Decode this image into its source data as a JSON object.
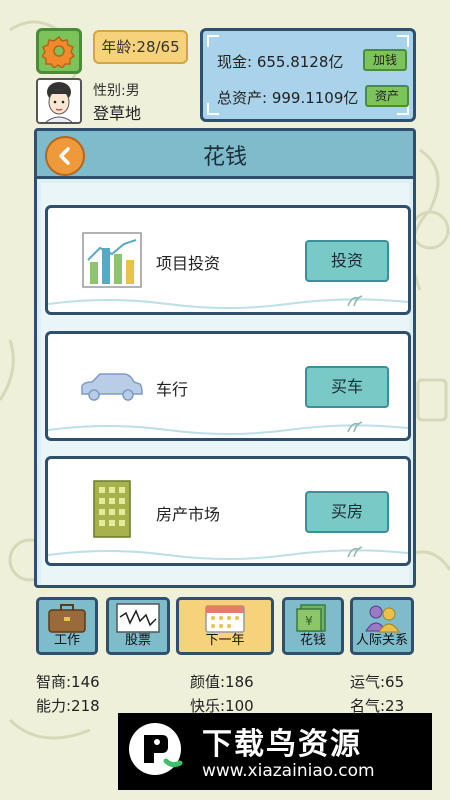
{
  "header": {
    "age_text": "年龄:28/65",
    "gender_text": "性别:男",
    "job_text": "登草地"
  },
  "money": {
    "cash_text": "现金: 655.8128亿",
    "add_money_label": "加钱",
    "total_text": "总资产: 999.1109亿",
    "assets_label": "资产"
  },
  "panel": {
    "title": "花钱",
    "cards": [
      {
        "label": "项目投资",
        "action": "投资",
        "icon": "bar-chart-icon"
      },
      {
        "label": "车行",
        "action": "买车",
        "icon": "car-icon"
      },
      {
        "label": "房产市场",
        "action": "买房",
        "icon": "building-icon"
      }
    ]
  },
  "nav": {
    "items": [
      {
        "label": "工作",
        "icon": "briefcase-icon"
      },
      {
        "label": "股票",
        "icon": "stock-chart-icon"
      },
      {
        "label": "下一年",
        "icon": "calendar-icon"
      },
      {
        "label": "花钱",
        "icon": "money-icon"
      },
      {
        "label": "人际关系",
        "icon": "people-icon"
      }
    ]
  },
  "stats": {
    "iq": "智商:146",
    "ability": "能力:218",
    "looks": "颜值:186",
    "happiness": "快乐:100",
    "luck": "运气:65",
    "fame": "名气:23"
  },
  "watermark": {
    "title": "下载鸟资源",
    "url": "www.xiazainiao.com"
  },
  "colors": {
    "panel_border": "#2f4f6c",
    "header_bg": "#7fbccb",
    "action_button": "#79c9c6",
    "green_button": "#7cc45a",
    "orange_back": "#ef9a3a"
  }
}
